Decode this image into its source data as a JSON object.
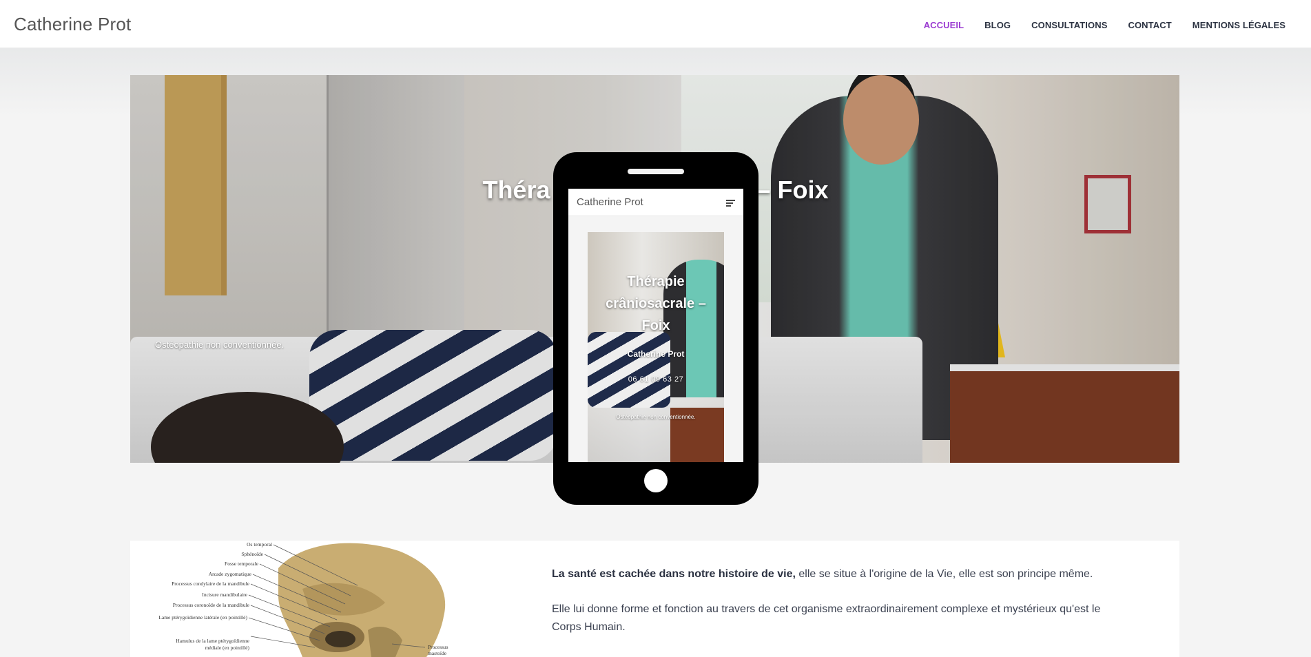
{
  "header": {
    "site_title": "Catherine Prot",
    "nav": [
      "ACCUEIL",
      "BLOG",
      "CONSULTATIONS",
      "CONTACT",
      "MENTIONS LÉGALES"
    ],
    "active": "ACCUEIL"
  },
  "hero": {
    "title_left": "Théra",
    "title_right": "– Foix",
    "tagline": "Ostéopathie non conventionnée."
  },
  "mobile_preview": {
    "site_title": "Catherine Prot",
    "hero_title": "Thérapie crâniosacrale – Foix",
    "name": "Catherine Prot",
    "phone": "06 61 09 63 27",
    "tagline": "Ostéopathie non conventionnée."
  },
  "anatomy_labels": [
    "Os temporal",
    "Sphénoïde",
    "Fosse temporale",
    "Arcade zygomatique",
    "Processus condylaire de la mandibule",
    "Incisure mandibulaire",
    "Processus coronoïde de la mandibule",
    "Lame ptérygoïdienne latérale (en pointillé)",
    "Hamulus de la lame ptérygoïdienne",
    "médiale (en pointillé)",
    "Processus",
    "mastoïde"
  ],
  "content": {
    "p1_bold": "La santé est cachée dans notre histoire de vie,",
    "p1_rest": " elle se situe à l'origine de la Vie, elle est son principe même.",
    "p2": "Elle lui donne forme et fonction au travers de cet organisme extraordinairement complexe et mystérieux qu'est le Corps Humain."
  },
  "colors": {
    "accent": "#9b3cd1",
    "nav_text": "#2c3342",
    "page_bg": "#f4f4f4"
  }
}
